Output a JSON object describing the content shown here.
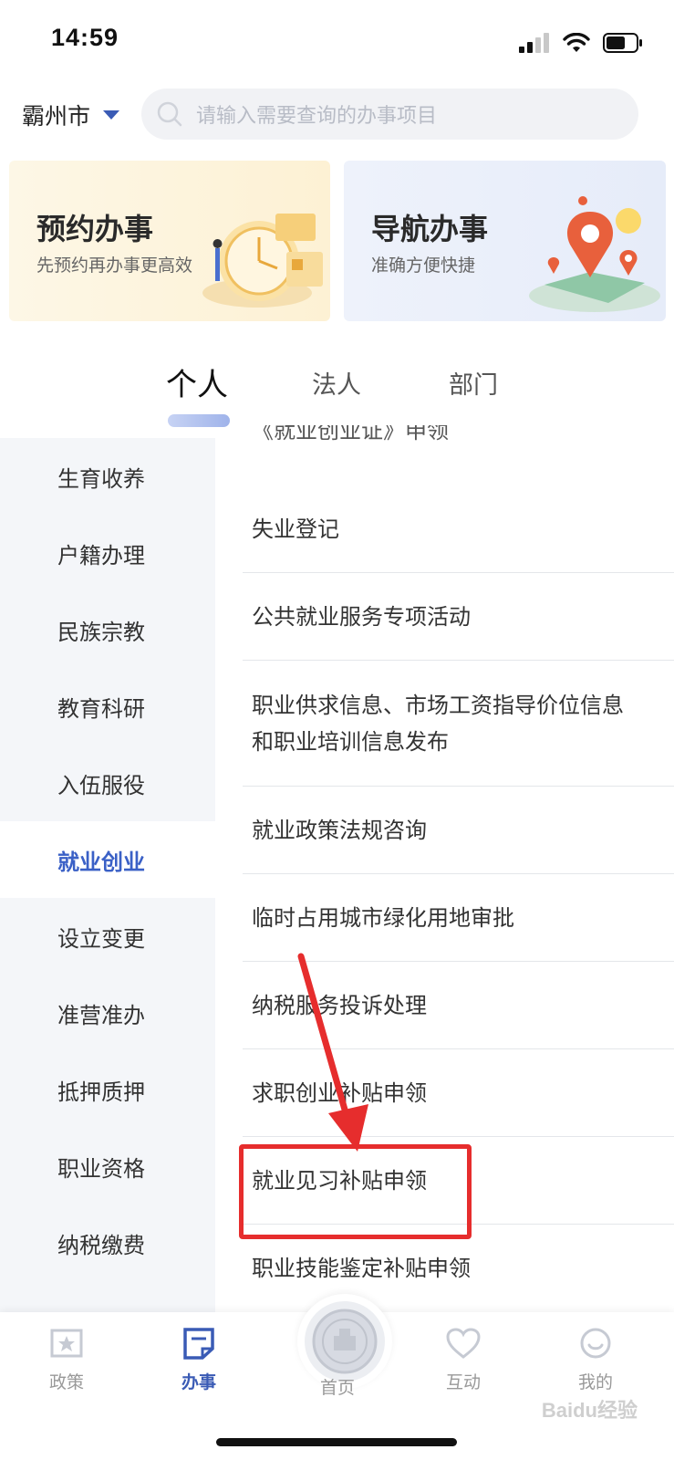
{
  "status_bar": {
    "time": "14:59"
  },
  "header": {
    "city": "霸州市",
    "search_placeholder": "请输入需要查询的办事项目"
  },
  "cards": [
    {
      "title": "预约办事",
      "subtitle": "先预约再办事更高效"
    },
    {
      "title": "导航办事",
      "subtitle": "准确方便快捷"
    }
  ],
  "tabs": [
    {
      "label": "个人",
      "active": true
    },
    {
      "label": "法人",
      "active": false
    },
    {
      "label": "部门",
      "active": false
    }
  ],
  "sidebar": {
    "items": [
      {
        "label": "生育收养"
      },
      {
        "label": "户籍办理"
      },
      {
        "label": "民族宗教"
      },
      {
        "label": "教育科研"
      },
      {
        "label": "入伍服役"
      },
      {
        "label": "就业创业",
        "active": true
      },
      {
        "label": "设立变更"
      },
      {
        "label": "准营准办"
      },
      {
        "label": "抵押质押"
      },
      {
        "label": "职业资格"
      },
      {
        "label": "纳税缴费"
      }
    ]
  },
  "services": {
    "partial_top": "《就业创业证》申领",
    "items": [
      {
        "label": "失业登记"
      },
      {
        "label": "公共就业服务专项活动"
      },
      {
        "label": "职业供求信息、市场工资指导价位信息和职业培训信息发布"
      },
      {
        "label": "就业政策法规咨询"
      },
      {
        "label": "临时占用城市绿化用地审批"
      },
      {
        "label": "纳税服务投诉处理"
      },
      {
        "label": "求职创业补贴申领"
      },
      {
        "label": "就业见习补贴申领",
        "highlighted": true
      },
      {
        "label": "职业技能鉴定补贴申领"
      }
    ]
  },
  "bottom_nav": {
    "items": [
      {
        "label": "政策",
        "icon": "policy-icon"
      },
      {
        "label": "办事",
        "icon": "affairs-icon",
        "active": true
      },
      {
        "label": "首页",
        "icon": "home-emblem-icon"
      },
      {
        "label": "互动",
        "icon": "heart-icon"
      },
      {
        "label": "我的",
        "icon": "smile-icon"
      }
    ]
  },
  "watermark": "Baidu经验",
  "colors": {
    "accent": "#3a5bb5",
    "annotation": "#e62d2d"
  }
}
